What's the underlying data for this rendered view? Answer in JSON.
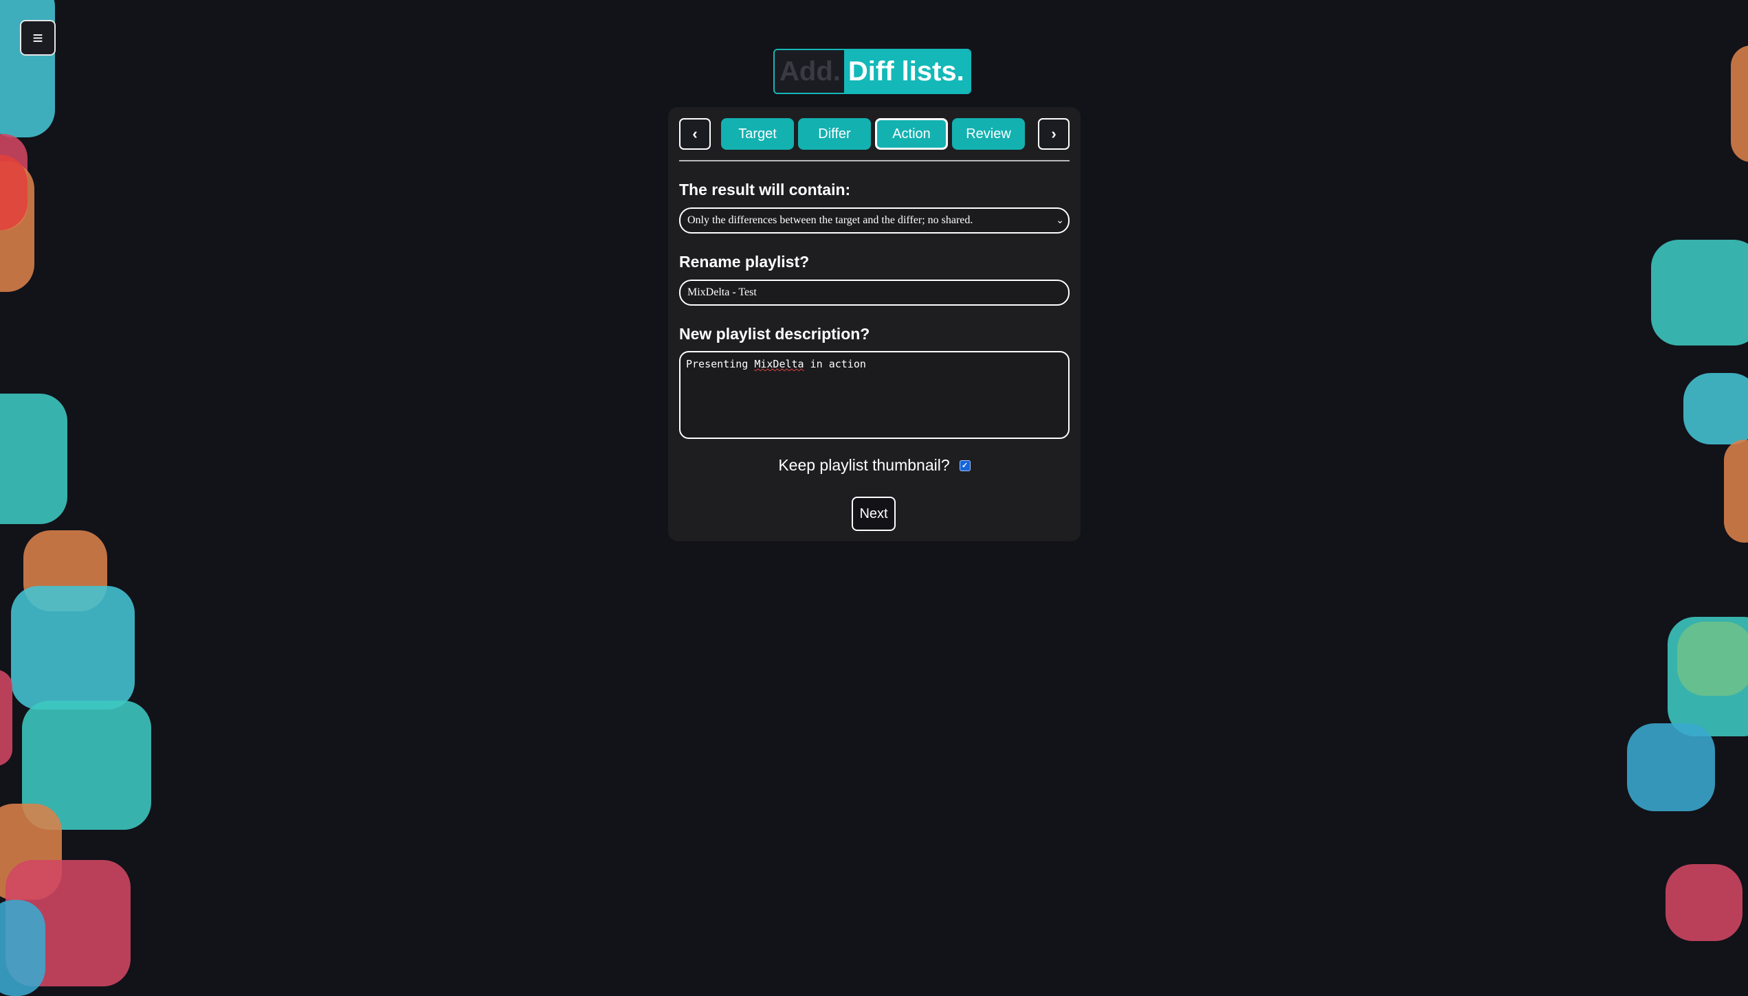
{
  "menu": {
    "icon": "hamburger-menu-icon",
    "glyph": "≡"
  },
  "logo": {
    "part_1": "Add.",
    "part_2": "Diff lists."
  },
  "wizard": {
    "prev_glyph": "‹",
    "next_glyph": "›",
    "tabs": [
      {
        "label": "Target",
        "active": false
      },
      {
        "label": "Differ",
        "active": false
      },
      {
        "label": "Action",
        "active": true
      },
      {
        "label": "Review",
        "active": false
      }
    ]
  },
  "form": {
    "result_label": "The result will contain:",
    "result_value": "Only the differences between the target and the differ; no shared.",
    "rename_label": "Rename playlist?",
    "rename_value": "MixDelta - Test",
    "description_label": "New playlist description?",
    "description_prefix": "Presenting ",
    "description_brand": "MixDelta",
    "description_suffix": " in action",
    "thumbnail_label": "Keep playlist thumbnail?",
    "thumbnail_checked": true,
    "next_label": "Next"
  },
  "colors": {
    "background": "#121219",
    "panel": "#1e1e21",
    "accent": "#14b1b1",
    "checkbox": "#1565d8"
  }
}
